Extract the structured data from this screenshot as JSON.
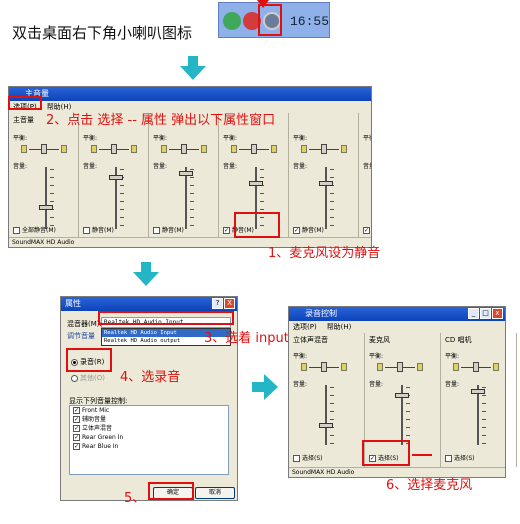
{
  "step1": {
    "text": "双击桌面右下角小喇叭图标",
    "clock": "16:55"
  },
  "mixer": {
    "title": "主音量",
    "menu": [
      "选项(P)",
      "帮助(H)"
    ],
    "channels": [
      {
        "title": "主音量",
        "mute": "全部静音(M)",
        "muted": false
      },
      {
        "title": "",
        "mute": "静音(M)",
        "muted": false
      },
      {
        "title": "",
        "mute": "静音(M)",
        "muted": false
      },
      {
        "title": "",
        "mute": "静音(M)",
        "muted": true
      },
      {
        "title": "",
        "mute": "静音(M)",
        "muted": true
      },
      {
        "title": "",
        "mute": "静音(M)",
        "muted": true
      }
    ],
    "balance_label": "平衡:",
    "volume_label": "音量:",
    "status": "SoundMAX HD Audio"
  },
  "annotations": {
    "a2": "2、点击 选择 -- 属性 弹出以下属性窗口",
    "a1": "1、麦克风设为静音",
    "a3": "3、选着 input设备",
    "a4": "4、选录音",
    "a5": "5、",
    "a6": "6、选择麦克风"
  },
  "props": {
    "title": "属性",
    "help_btn": "?",
    "close_btn": "X",
    "mixer_device_label": "混音器(M):",
    "mixer_device_value": "Realtek HD Audio Input",
    "dropdown_options": [
      "Realtek HD Audio Input",
      "Realtek HD Audio output"
    ],
    "adjust_label": "调节音量",
    "radio_record": "录音(R)",
    "radio_other": "其他(O)",
    "list_label": "显示下列音量控制:",
    "list_items": [
      "Front Mic",
      "辅助音量",
      "立体声混音",
      "Rear Green In",
      "Rear Blue In"
    ],
    "ok": "确定",
    "cancel": "取消"
  },
  "record": {
    "title": "录音控制",
    "menu": [
      "选项(P)",
      "帮助(H)"
    ],
    "channels": [
      {
        "title": "立体声混音",
        "select": "选择(S)",
        "selected": false
      },
      {
        "title": "麦克风",
        "select": "选择(S)",
        "selected": true
      },
      {
        "title": "CD 唱机",
        "select": "选择(S)",
        "selected": false
      }
    ],
    "balance_label": "平衡:",
    "volume_label": "音量:",
    "status": "SoundMAX HD Audio"
  },
  "colors": {
    "accent_red": "#e01010",
    "arrow_cyan": "#24b6c6",
    "title_blue": "#0c44b8"
  }
}
